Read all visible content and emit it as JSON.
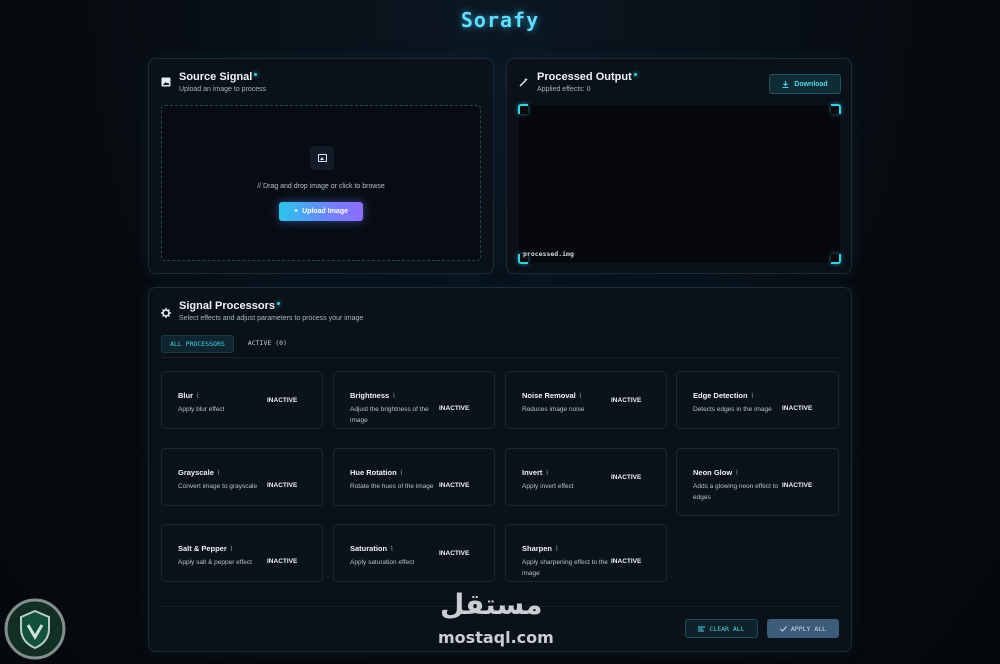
{
  "app": {
    "title": "Sorafy"
  },
  "source": {
    "title": "Source Signal",
    "subtitle": "Upload an image to process",
    "drop_text": "// Drag and drop image or click to browse",
    "upload_label": "Upload Image"
  },
  "output": {
    "title": "Processed Output",
    "subtitle": "Applied effects: 0",
    "download_label": "Download",
    "file_label": "processed.img"
  },
  "processors": {
    "title": "Signal Processors",
    "subtitle": "Select effects and adjust parameters to process your image",
    "tabs": [
      {
        "label": "ALL PROCESSORS",
        "active": true
      },
      {
        "label": "ACTIVE (0)",
        "active": false
      }
    ],
    "items": [
      {
        "name": "Blur",
        "desc": "Apply blur effect",
        "status": "INACTIVE"
      },
      {
        "name": "Brightness",
        "desc": "Adjust the brightness of the image",
        "status": "INACTIVE"
      },
      {
        "name": "Noise Removal",
        "desc": "Reduces image noise",
        "status": "INACTIVE"
      },
      {
        "name": "Edge Detection",
        "desc": "Detects edges in the image",
        "status": "INACTIVE"
      },
      {
        "name": "Grayscale",
        "desc": "Convert image to grayscale",
        "status": "INACTIVE"
      },
      {
        "name": "Hue Rotation",
        "desc": "Rotate the hues of the image",
        "status": "INACTIVE"
      },
      {
        "name": "Invert",
        "desc": "Apply invert effect",
        "status": "INACTIVE"
      },
      {
        "name": "Neon Glow",
        "desc": "Adds a glowing neon effect to edges",
        "status": "INACTIVE"
      },
      {
        "name": "Salt & Pepper",
        "desc": "Apply salt & pepper effect",
        "status": "INACTIVE"
      },
      {
        "name": "Saturation",
        "desc": "Apply saturation effect",
        "status": "INACTIVE"
      },
      {
        "name": "Sharpen",
        "desc": "Apply sharpening effect to the image",
        "status": "INACTIVE"
      }
    ],
    "clear_label": "CLEAR ALL",
    "apply_label": "APPLY ALL"
  },
  "watermark": {
    "arabic": "مستقل",
    "latin": "mostaql.com"
  },
  "colors": {
    "accent": "#2ad4e6",
    "panel_bg": "#0b1118",
    "page_bg": "#070b10",
    "gradient_start": "#28c6ea",
    "gradient_end": "#8f6cff"
  },
  "icons": {
    "source": "image-icon",
    "output": "magic-wand-icon",
    "processors": "gear-icon",
    "upload": "plus-icon",
    "download": "download-icon",
    "clear": "list-clear-icon",
    "apply": "check-icon",
    "wave": "waveform-icon"
  }
}
